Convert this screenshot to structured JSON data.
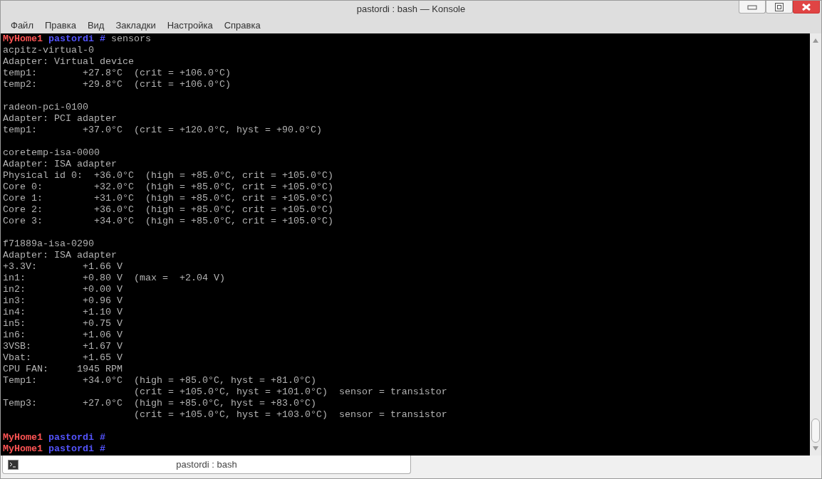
{
  "window": {
    "title": "pastordi : bash — Konsole"
  },
  "menu": [
    "Файл",
    "Правка",
    "Вид",
    "Закладки",
    "Настройка",
    "Справка"
  ],
  "terminal": {
    "lines": [
      {
        "kind": "prompt",
        "host": "MyHome1",
        "user": "pastordi",
        "symbol": "#",
        "command": "sensors"
      },
      {
        "kind": "output",
        "text": "acpitz-virtual-0"
      },
      {
        "kind": "output",
        "text": "Adapter: Virtual device"
      },
      {
        "kind": "output",
        "text": "temp1:        +27.8°C  (crit = +106.0°C)"
      },
      {
        "kind": "output",
        "text": "temp2:        +29.8°C  (crit = +106.0°C)"
      },
      {
        "kind": "blank"
      },
      {
        "kind": "output",
        "text": "radeon-pci-0100"
      },
      {
        "kind": "output",
        "text": "Adapter: PCI adapter"
      },
      {
        "kind": "output",
        "text": "temp1:        +37.0°C  (crit = +120.0°C, hyst = +90.0°C)"
      },
      {
        "kind": "blank"
      },
      {
        "kind": "output",
        "text": "coretemp-isa-0000"
      },
      {
        "kind": "output",
        "text": "Adapter: ISA adapter"
      },
      {
        "kind": "output",
        "text": "Physical id 0:  +36.0°C  (high = +85.0°C, crit = +105.0°C)"
      },
      {
        "kind": "output",
        "text": "Core 0:         +32.0°C  (high = +85.0°C, crit = +105.0°C)"
      },
      {
        "kind": "output",
        "text": "Core 1:         +31.0°C  (high = +85.0°C, crit = +105.0°C)"
      },
      {
        "kind": "output",
        "text": "Core 2:         +36.0°C  (high = +85.0°C, crit = +105.0°C)"
      },
      {
        "kind": "output",
        "text": "Core 3:         +34.0°C  (high = +85.0°C, crit = +105.0°C)"
      },
      {
        "kind": "blank"
      },
      {
        "kind": "output",
        "text": "f71889a-isa-0290"
      },
      {
        "kind": "output",
        "text": "Adapter: ISA adapter"
      },
      {
        "kind": "output",
        "text": "+3.3V:        +1.66 V"
      },
      {
        "kind": "output",
        "text": "in1:          +0.80 V  (max =  +2.04 V)"
      },
      {
        "kind": "output",
        "text": "in2:          +0.00 V"
      },
      {
        "kind": "output",
        "text": "in3:          +0.96 V"
      },
      {
        "kind": "output",
        "text": "in4:          +1.10 V"
      },
      {
        "kind": "output",
        "text": "in5:          +0.75 V"
      },
      {
        "kind": "output",
        "text": "in6:          +1.06 V"
      },
      {
        "kind": "output",
        "text": "3VSB:         +1.67 V"
      },
      {
        "kind": "output",
        "text": "Vbat:         +1.65 V"
      },
      {
        "kind": "output",
        "text": "CPU FAN:     1945 RPM"
      },
      {
        "kind": "output",
        "text": "Temp1:        +34.0°C  (high = +85.0°C, hyst = +81.0°C)"
      },
      {
        "kind": "output",
        "text": "                       (crit = +105.0°C, hyst = +101.0°C)  sensor = transistor"
      },
      {
        "kind": "output",
        "text": "Temp3:        +27.0°C  (high = +85.0°C, hyst = +83.0°C)"
      },
      {
        "kind": "output",
        "text": "                       (crit = +105.0°C, hyst = +103.0°C)  sensor = transistor"
      },
      {
        "kind": "blank"
      },
      {
        "kind": "prompt",
        "host": "MyHome1",
        "user": "pastordi",
        "symbol": "#"
      },
      {
        "kind": "prompt",
        "host": "MyHome1",
        "user": "pastordi",
        "symbol": "#"
      }
    ]
  },
  "tabs": [
    {
      "label": "pastordi : bash",
      "selected": true
    }
  ]
}
